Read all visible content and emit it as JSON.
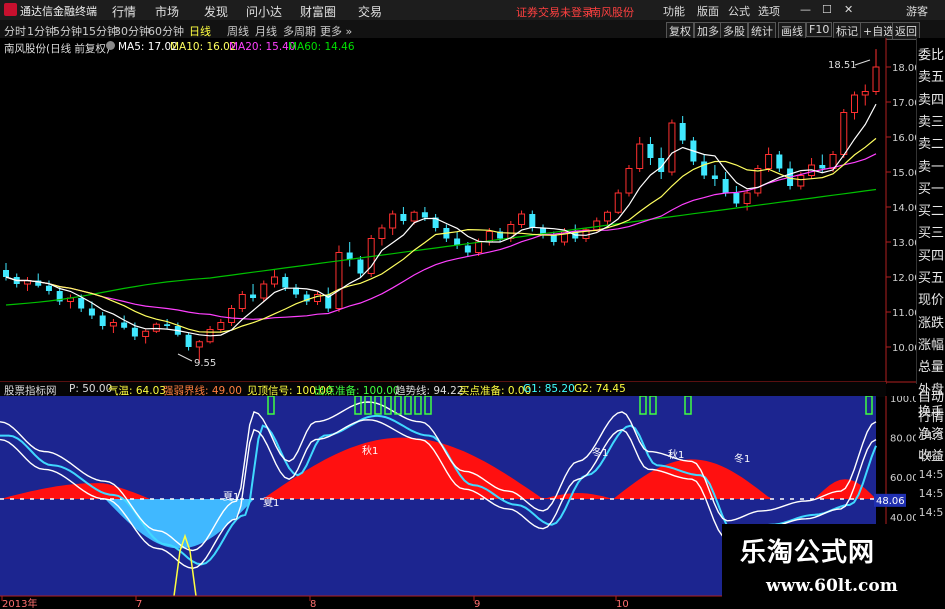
{
  "titlebar": {
    "app_name": "通达信金融终端",
    "menus": [
      "行情",
      "市场",
      "发现",
      "问小达",
      "财富圈",
      "交易"
    ],
    "warning": "证券交易未登录",
    "stock_name": "南风股份",
    "right_menus": [
      "功能",
      "版面",
      "公式",
      "选项"
    ],
    "guest": "游客"
  },
  "periods": [
    "分时",
    "1分钟",
    "5分钟",
    "15分钟",
    "30分钟",
    "60分钟",
    "日线",
    "周线",
    "月线",
    "多周期",
    "更多 »"
  ],
  "active_period": "日线",
  "right_tools": [
    "复权",
    "加多",
    "多股",
    "统计",
    "画线",
    "F10",
    "标记",
    "+自选",
    "返回"
  ],
  "price_legend": {
    "name": "南风股份(日线 前复权)",
    "ma5": "MA5: 17.02",
    "ma10": "MA10: 16.02",
    "ma20": "MA20: 15.40",
    "ma60": "MA60: 14.46"
  },
  "price_axis": [
    "18.00",
    "17.00",
    "16.00",
    "15.00",
    "14.00",
    "13.00",
    "12.00",
    "11.00",
    "10.00"
  ],
  "price_high_label": "18.51",
  "price_low_label": "9.55",
  "side_labels": [
    "委比",
    "卖五",
    "卖四",
    "卖三",
    "卖二",
    "卖一",
    "买一",
    "买二",
    "买三",
    "买四",
    "买五",
    "现价",
    "涨跌",
    "涨幅",
    "总量",
    "外盘",
    "换手",
    "净资",
    "收益",
    "自动",
    "行情"
  ],
  "side_times": [
    "14:5",
    "14:5",
    "14:5",
    "14:5",
    "14:5",
    "14:5",
    "14:5",
    "14:5",
    "14:5"
  ],
  "indicator": {
    "name": "股票指标网",
    "p": "P: 50.00",
    "qiwen": "气温: 64.03",
    "qiangruo": "强弱界线: 49.00",
    "jianding": "见顶信号: 100.00",
    "chudian": "出点准备: 100.00",
    "qushi": "趋势线: 94.22",
    "maidian": "买点准备: 0.00",
    "g1": "G1: 85.20",
    "g2": "G2: 74.45"
  },
  "ind_axis": [
    "100.00",
    "80.00",
    "60.00",
    "40.00"
  ],
  "ind_current": "48.06",
  "ind_labels": [
    "秋1",
    "冬1",
    "秋1",
    "冬1",
    "夏1",
    "夏1"
  ],
  "dates": [
    "2013年",
    "7",
    "8",
    "9",
    "10"
  ],
  "watermark": {
    "title": "乐淘公式网",
    "url": "www.60lt.com"
  },
  "colors": {
    "up": "#ff3030",
    "down": "#40e8ff",
    "ma5": "#ffffff",
    "ma10": "#ffff60",
    "ma20": "#ff40ff",
    "ma60": "#00c000",
    "ind_bg": "#1c2590",
    "ind_red": "#ff1010",
    "ind_cyan": "#40b8ff"
  },
  "candles": [
    [
      12.2,
      12.4,
      11.9,
      12.0
    ],
    [
      12.0,
      12.1,
      11.7,
      11.8
    ],
    [
      11.8,
      12.0,
      11.6,
      11.9
    ],
    [
      11.9,
      12.1,
      11.7,
      11.75
    ],
    [
      11.75,
      11.9,
      11.5,
      11.6
    ],
    [
      11.6,
      11.7,
      11.2,
      11.3
    ],
    [
      11.3,
      11.5,
      11.1,
      11.4
    ],
    [
      11.4,
      11.5,
      11.0,
      11.1
    ],
    [
      11.1,
      11.3,
      10.8,
      10.9
    ],
    [
      10.9,
      11.0,
      10.5,
      10.6
    ],
    [
      10.6,
      10.8,
      10.4,
      10.7
    ],
    [
      10.7,
      10.9,
      10.5,
      10.55
    ],
    [
      10.55,
      10.7,
      10.2,
      10.3
    ],
    [
      10.3,
      10.5,
      10.1,
      10.45
    ],
    [
      10.45,
      10.7,
      10.4,
      10.65
    ],
    [
      10.65,
      10.8,
      10.5,
      10.6
    ],
    [
      10.6,
      10.7,
      10.3,
      10.35
    ],
    [
      10.35,
      10.4,
      9.9,
      10.0
    ],
    [
      10.0,
      10.2,
      9.55,
      10.15
    ],
    [
      10.15,
      10.6,
      10.1,
      10.5
    ],
    [
      10.5,
      10.8,
      10.4,
      10.7
    ],
    [
      10.7,
      11.2,
      10.6,
      11.1
    ],
    [
      11.1,
      11.6,
      11.0,
      11.5
    ],
    [
      11.5,
      11.8,
      11.3,
      11.4
    ],
    [
      11.4,
      11.9,
      11.3,
      11.8
    ],
    [
      11.8,
      12.2,
      11.7,
      12.0
    ],
    [
      12.0,
      12.1,
      11.6,
      11.7
    ],
    [
      11.7,
      11.8,
      11.4,
      11.5
    ],
    [
      11.5,
      11.6,
      11.2,
      11.3
    ],
    [
      11.3,
      11.6,
      11.2,
      11.5
    ],
    [
      11.5,
      11.7,
      11.0,
      11.1
    ],
    [
      11.1,
      12.9,
      11.0,
      12.7
    ],
    [
      12.7,
      13.0,
      12.3,
      12.5
    ],
    [
      12.5,
      12.6,
      12.0,
      12.1
    ],
    [
      12.1,
      13.2,
      12.0,
      13.1
    ],
    [
      13.1,
      13.5,
      12.9,
      13.4
    ],
    [
      13.4,
      13.9,
      13.2,
      13.8
    ],
    [
      13.8,
      14.0,
      13.5,
      13.6
    ],
    [
      13.6,
      13.9,
      13.5,
      13.85
    ],
    [
      13.85,
      14.0,
      13.6,
      13.7
    ],
    [
      13.7,
      13.8,
      13.3,
      13.4
    ],
    [
      13.4,
      13.5,
      13.0,
      13.1
    ],
    [
      13.1,
      13.3,
      12.8,
      12.9
    ],
    [
      12.9,
      13.0,
      12.6,
      12.7
    ],
    [
      12.7,
      13.1,
      12.6,
      13.0
    ],
    [
      13.0,
      13.4,
      12.9,
      13.3
    ],
    [
      13.3,
      13.4,
      13.0,
      13.1
    ],
    [
      13.1,
      13.6,
      13.0,
      13.5
    ],
    [
      13.5,
      13.9,
      13.4,
      13.8
    ],
    [
      13.8,
      13.9,
      13.3,
      13.4
    ],
    [
      13.4,
      13.5,
      13.1,
      13.2
    ],
    [
      13.2,
      13.3,
      12.9,
      13.0
    ],
    [
      13.0,
      13.4,
      12.9,
      13.3
    ],
    [
      13.3,
      13.5,
      13.0,
      13.1
    ],
    [
      13.1,
      13.4,
      13.0,
      13.35
    ],
    [
      13.35,
      13.7,
      13.3,
      13.6
    ],
    [
      13.6,
      13.9,
      13.5,
      13.85
    ],
    [
      13.85,
      14.5,
      13.8,
      14.4
    ],
    [
      14.4,
      15.2,
      14.3,
      15.1
    ],
    [
      15.1,
      16.0,
      15.0,
      15.8
    ],
    [
      15.8,
      16.0,
      15.2,
      15.4
    ],
    [
      15.4,
      15.7,
      14.8,
      15.0
    ],
    [
      15.0,
      16.5,
      14.9,
      16.4
    ],
    [
      16.4,
      16.6,
      15.8,
      15.9
    ],
    [
      15.9,
      16.0,
      15.2,
      15.3
    ],
    [
      15.3,
      15.5,
      14.8,
      14.9
    ],
    [
      14.9,
      15.2,
      14.6,
      14.8
    ],
    [
      14.8,
      15.0,
      14.3,
      14.4
    ],
    [
      14.4,
      14.6,
      14.0,
      14.1
    ],
    [
      14.1,
      14.5,
      13.9,
      14.4
    ],
    [
      14.4,
      15.2,
      14.3,
      15.1
    ],
    [
      15.1,
      15.7,
      15.0,
      15.5
    ],
    [
      15.5,
      15.6,
      15.0,
      15.1
    ],
    [
      15.1,
      15.3,
      14.5,
      14.6
    ],
    [
      14.6,
      15.0,
      14.5,
      14.9
    ],
    [
      14.9,
      15.4,
      14.8,
      15.2
    ],
    [
      15.2,
      15.5,
      15.0,
      15.1
    ],
    [
      15.1,
      15.6,
      15.0,
      15.5
    ],
    [
      15.5,
      16.8,
      15.4,
      16.7
    ],
    [
      16.7,
      17.3,
      16.5,
      17.2
    ],
    [
      17.2,
      17.5,
      16.9,
      17.3
    ],
    [
      17.3,
      18.51,
      17.2,
      18.0
    ]
  ]
}
